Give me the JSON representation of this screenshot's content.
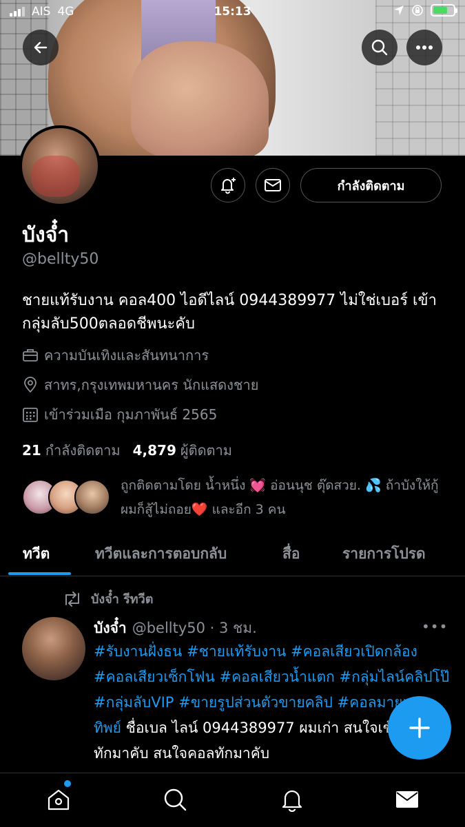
{
  "status_bar": {
    "carrier": "AIS",
    "network": "4G",
    "time": "15:13"
  },
  "profile": {
    "name": "บังจ๋ำ",
    "handle": "@bellty50",
    "follow_button_label": "กำลังติดตาม",
    "bio": "ชายแท้รับงาน คอล400 ไอดีไลน์ 0944389977 ไม่ใช่เบอร์ เข้ากลุ่มลับ500ตลอดชีพนะคับ",
    "category": "ความบันเทิงและสันทนาการ",
    "location": "สาทร,กรุงเทพมหานคร นักแสดงชาย",
    "joined": "เข้าร่วมเมือ กุมภาพันธ์ 2565",
    "following_count": "21",
    "following_label": "กำลังติดตาม",
    "followers_count": "4,879",
    "followers_label": "ผู้ติดตาม",
    "followed_by_text": "ถูกติดตามโดย น้ำหนึ่ง 💓 อ่อนนุช ตุ๊ดสวย. 💦 ถ้าบังให้กู้ ผมก็สู้ไม่ถอย❤️ และอีก 3 คน"
  },
  "tabs": [
    {
      "label": "ทวีต"
    },
    {
      "label": "ทวีตและการตอบกลับ"
    },
    {
      "label": "สื่อ"
    },
    {
      "label": "รายการโปรด"
    }
  ],
  "tweet": {
    "retweet_label": "บังจ๋ำ รีทวีต",
    "author_name": "บังจ๋ำ",
    "author_handle_time": "@bellty50 · 3 ชม.",
    "more": "•••",
    "hashtags": "#รับงานฝั่งธน #ชายแท้รับงาน #คอลเสียวเปิดกล้อง #คอลเสียวเซ็กโฟน #คอลเสียวน้ำแตก #กลุ่มไลน์คลิปโป๊ #กลุ่มลับVIP #ขายรูปส่วนตัวขายคลิป #คอลมายเนมฉุทิพย์",
    "body": " ชื่อเบล ไลน์ 0944389977 ผมเก่า สนใจเข้ากลุ่มลับทักมาคับ สนใจคอลทักมาคับ"
  },
  "icons": {
    "back": "arrow-left-icon",
    "search": "search-icon",
    "more": "more-horizontal-icon",
    "notify": "bell-plus-icon",
    "message": "envelope-icon",
    "compose": "plus-icon"
  },
  "colors": {
    "accent": "#1d9bf0",
    "muted": "#8b9197",
    "background": "#000000"
  }
}
